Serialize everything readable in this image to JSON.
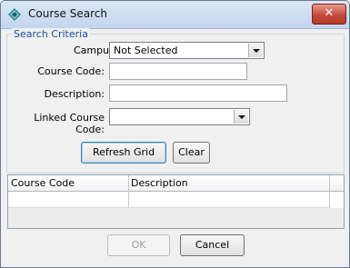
{
  "window": {
    "title": "Course Search",
    "icon": "diamond-app-icon",
    "close_glyph": "✕"
  },
  "criteria": {
    "legend": "Search Criteria",
    "campus_label": "Campus:",
    "campus_value": "Not Selected",
    "course_code_label": "Course Code:",
    "course_code_value": "",
    "description_label": "Description:",
    "description_value": "",
    "linked_course_code_label": "Linked Course Code:",
    "linked_course_code_value": ""
  },
  "actions": {
    "refresh_label": "Refresh Grid",
    "clear_label": "Clear"
  },
  "grid": {
    "columns": [
      "Course Code",
      "Description"
    ],
    "rows": []
  },
  "footer": {
    "ok_label": "OK",
    "cancel_label": "Cancel"
  },
  "colors": {
    "legend": "#1d4fa5",
    "titlebar": "#c3d6ee",
    "close": "#c44b3b"
  }
}
